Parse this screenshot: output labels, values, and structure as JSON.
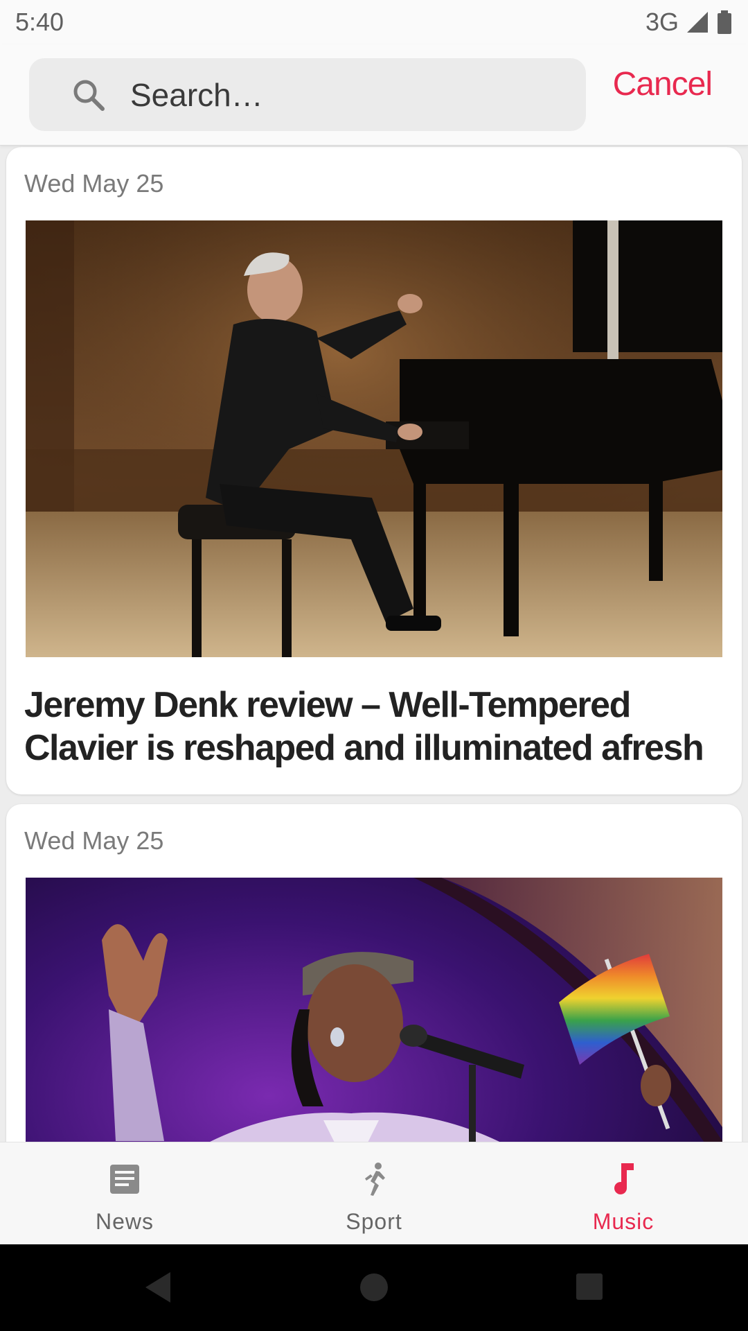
{
  "status_bar": {
    "time": "5:40",
    "network": "3G"
  },
  "search": {
    "placeholder": "Search…",
    "value": "",
    "cancel_label": "Cancel"
  },
  "articles": [
    {
      "date": "Wed May 25",
      "title": "Jeremy Denk review – Well-Tempered Clavier is reshaped and illuminated afresh",
      "image": "pianist-performing-at-grand-piano"
    },
    {
      "date": "Wed May 25",
      "title": "",
      "image": "singer-with-microphone-and-rainbow-flag"
    }
  ],
  "tabs": [
    {
      "label": "News",
      "icon": "news-icon",
      "active": false
    },
    {
      "label": "Sport",
      "icon": "sport-icon",
      "active": false
    },
    {
      "label": "Music",
      "icon": "music-note-icon",
      "active": true
    }
  ],
  "colors": {
    "accent": "#e8294f",
    "inactive_tab": "#666666",
    "background": "#ededed"
  },
  "system_nav": [
    "back",
    "home",
    "recents"
  ]
}
